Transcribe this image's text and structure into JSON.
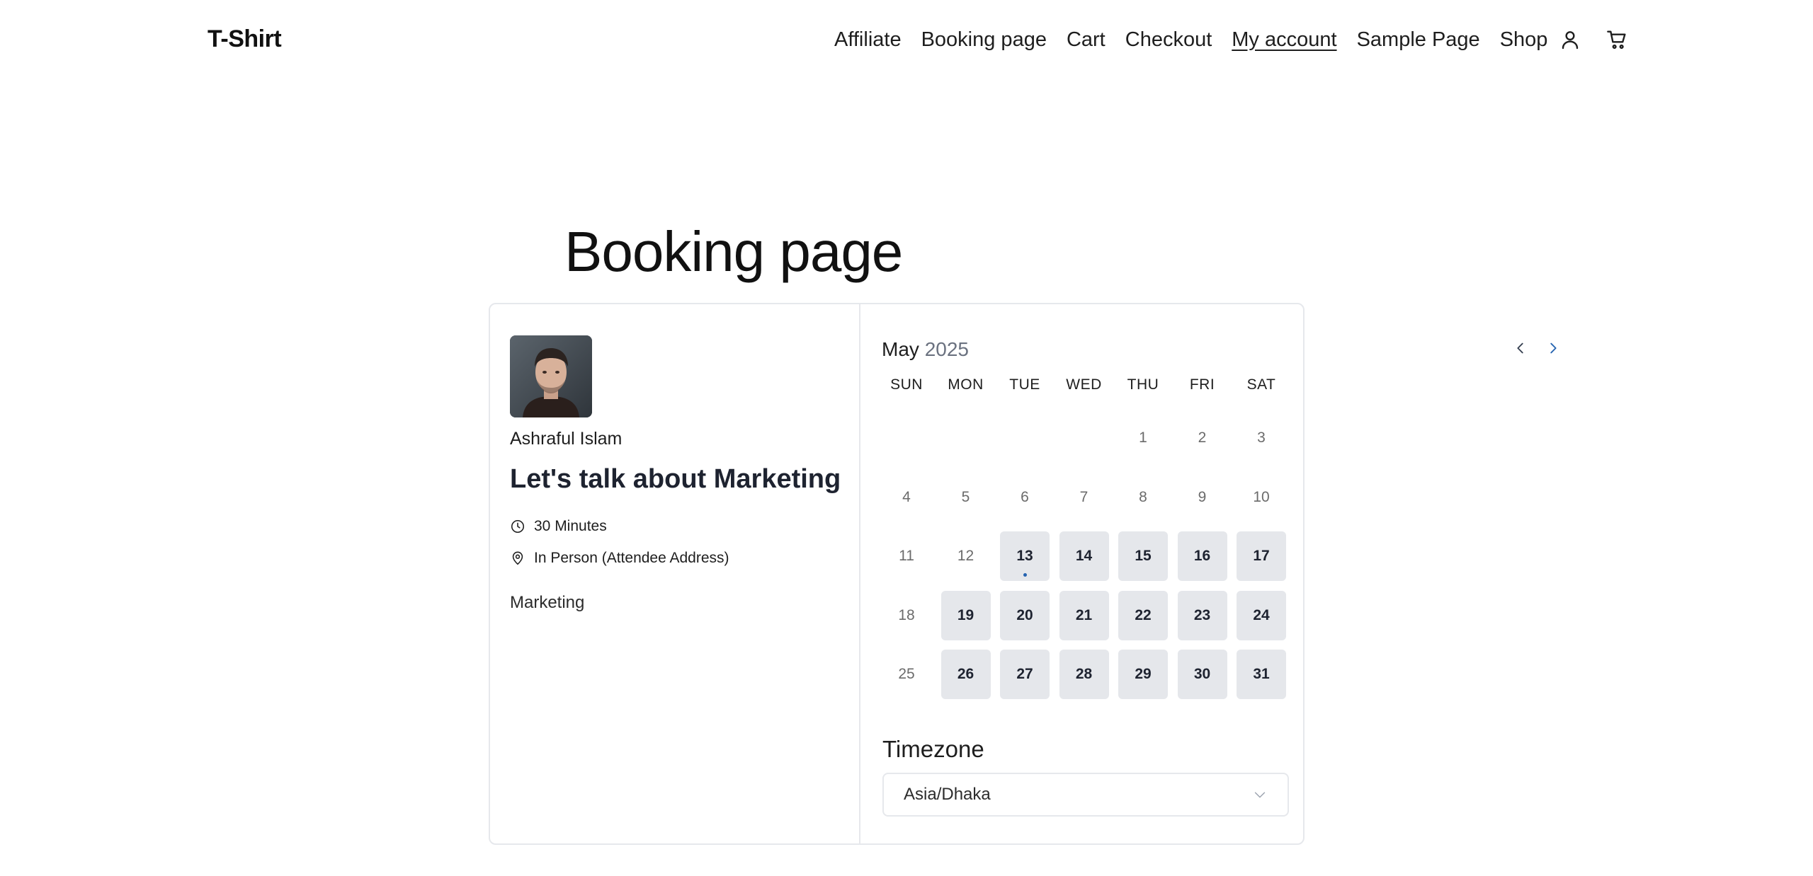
{
  "site": {
    "title": "T-Shirt"
  },
  "nav": {
    "items": [
      {
        "label": "Affiliate"
      },
      {
        "label": "Booking page"
      },
      {
        "label": "Cart"
      },
      {
        "label": "Checkout"
      },
      {
        "label": "My account",
        "current": true
      },
      {
        "label": "Sample Page"
      },
      {
        "label": "Shop"
      }
    ],
    "account_icon": "user-icon",
    "cart_icon": "cart-icon"
  },
  "page": {
    "title": "Booking page"
  },
  "event": {
    "host_name": "Ashraful Islam",
    "title": "Let's talk about Marketing",
    "duration": "30 Minutes",
    "location": "In Person (Attendee Address)",
    "description": "Marketing",
    "duration_icon": "clock-icon",
    "location_icon": "map-pin-icon"
  },
  "calendar": {
    "month": "May",
    "year": "2025",
    "weekdays": [
      "SUN",
      "MON",
      "TUE",
      "WED",
      "THU",
      "FRI",
      "SAT"
    ],
    "days": [
      {
        "label": ""
      },
      {
        "label": ""
      },
      {
        "label": ""
      },
      {
        "label": ""
      },
      {
        "label": "1"
      },
      {
        "label": "2"
      },
      {
        "label": "3"
      },
      {
        "label": "4"
      },
      {
        "label": "5"
      },
      {
        "label": "6"
      },
      {
        "label": "7"
      },
      {
        "label": "8"
      },
      {
        "label": "9"
      },
      {
        "label": "10"
      },
      {
        "label": "11"
      },
      {
        "label": "12"
      },
      {
        "label": "13",
        "available": true,
        "today": true
      },
      {
        "label": "14",
        "available": true
      },
      {
        "label": "15",
        "available": true
      },
      {
        "label": "16",
        "available": true
      },
      {
        "label": "17",
        "available": true
      },
      {
        "label": "18"
      },
      {
        "label": "19",
        "available": true
      },
      {
        "label": "20",
        "available": true
      },
      {
        "label": "21",
        "available": true
      },
      {
        "label": "22",
        "available": true
      },
      {
        "label": "23",
        "available": true
      },
      {
        "label": "24",
        "available": true
      },
      {
        "label": "25"
      },
      {
        "label": "26",
        "available": true
      },
      {
        "label": "27",
        "available": true
      },
      {
        "label": "28",
        "available": true
      },
      {
        "label": "29",
        "available": true
      },
      {
        "label": "30",
        "available": true
      },
      {
        "label": "31",
        "available": true
      }
    ],
    "prev_icon": "chevron-left-icon",
    "next_icon": "chevron-right-icon"
  },
  "timezone": {
    "label": "Timezone",
    "value": "Asia/Dhaka"
  },
  "colors": {
    "accent": "#2563b0",
    "available_bg": "#e5e7eb",
    "border": "#e6e8ec"
  }
}
